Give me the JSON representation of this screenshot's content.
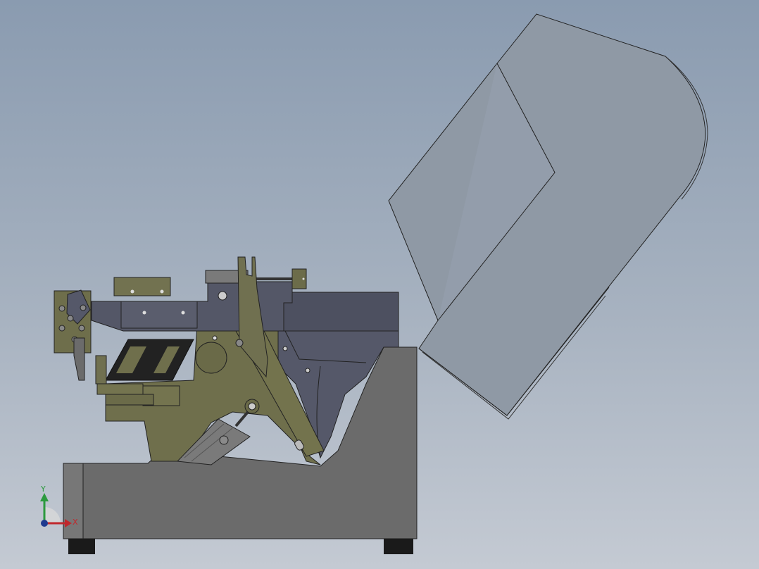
{
  "viewport": {
    "background_top": "#8a9bb0",
    "background_bottom": "#c4cad3"
  },
  "colors": {
    "base_gray": "#6b6b6b",
    "olive_frame": "#6f6f4c",
    "dark_slate": "#4d5060",
    "cover_gray": "#8f99a5",
    "foot_black": "#1a1a1a"
  },
  "triad": {
    "x_label": "X",
    "y_label": "Y",
    "x_color": "#c0282d",
    "y_color": "#2c9a3e",
    "origin_color": "#1e3a8f"
  }
}
